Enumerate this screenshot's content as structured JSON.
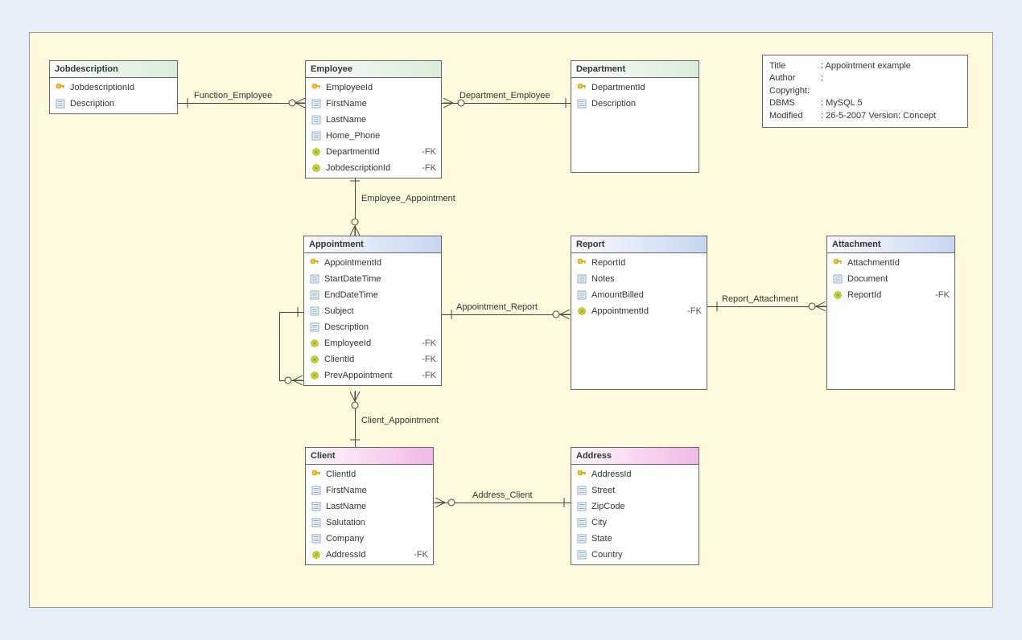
{
  "info": {
    "title_label": "Title",
    "title_value": "Appointment example",
    "author_label": "Author",
    "author_value": "",
    "copyright_label": "Copyright:",
    "dbms_label": "DBMS",
    "dbms_value": "MySQL 5",
    "modified_label": "Modified",
    "modified_value": "26-5-2007 Version: Concept"
  },
  "entities": {
    "jobdescription": {
      "title": "Jobdescription",
      "columns": [
        {
          "name": "JobdescriptionId",
          "icon": "key"
        },
        {
          "name": "Description",
          "icon": "field"
        }
      ]
    },
    "employee": {
      "title": "Employee",
      "columns": [
        {
          "name": "EmployeeId",
          "icon": "key"
        },
        {
          "name": "FirstName",
          "icon": "field"
        },
        {
          "name": "LastName",
          "icon": "field"
        },
        {
          "name": "Home_Phone",
          "icon": "field"
        },
        {
          "name": "DepartmentId",
          "icon": "fk",
          "fk": "-FK"
        },
        {
          "name": "JobdescriptionId",
          "icon": "fk",
          "fk": "-FK"
        }
      ]
    },
    "department": {
      "title": "Department",
      "columns": [
        {
          "name": "DepartmentId",
          "icon": "key"
        },
        {
          "name": "Description",
          "icon": "field"
        }
      ]
    },
    "appointment": {
      "title": "Appointment",
      "columns": [
        {
          "name": "AppointmentId",
          "icon": "key"
        },
        {
          "name": "StartDateTime",
          "icon": "field"
        },
        {
          "name": "EndDateTime",
          "icon": "field"
        },
        {
          "name": "Subject",
          "icon": "field"
        },
        {
          "name": "Description",
          "icon": "field"
        },
        {
          "name": "EmployeeId",
          "icon": "fk",
          "fk": "-FK"
        },
        {
          "name": "ClientId",
          "icon": "fk",
          "fk": "-FK"
        },
        {
          "name": "PrevAppointment",
          "icon": "fk",
          "fk": "-FK"
        }
      ]
    },
    "report": {
      "title": "Report",
      "columns": [
        {
          "name": "ReportId",
          "icon": "key"
        },
        {
          "name": "Notes",
          "icon": "field"
        },
        {
          "name": "AmountBilled",
          "icon": "field"
        },
        {
          "name": "AppointmentId",
          "icon": "fk",
          "fk": "-FK"
        }
      ]
    },
    "attachment": {
      "title": "Attachment",
      "columns": [
        {
          "name": "AttachmentId",
          "icon": "key"
        },
        {
          "name": "Document",
          "icon": "field"
        },
        {
          "name": "ReportId",
          "icon": "fk",
          "fk": "-FK"
        }
      ]
    },
    "client": {
      "title": "Client",
      "columns": [
        {
          "name": "ClientId",
          "icon": "key"
        },
        {
          "name": "FirstName",
          "icon": "field"
        },
        {
          "name": "LastName",
          "icon": "field"
        },
        {
          "name": "Salutation",
          "icon": "field"
        },
        {
          "name": "Company",
          "icon": "field"
        },
        {
          "name": "AddressId",
          "icon": "fk",
          "fk": "-FK"
        }
      ]
    },
    "address": {
      "title": "Address",
      "columns": [
        {
          "name": "AddressId",
          "icon": "key"
        },
        {
          "name": "Street",
          "icon": "field"
        },
        {
          "name": "ZipCode",
          "icon": "field"
        },
        {
          "name": "City",
          "icon": "field"
        },
        {
          "name": "State",
          "icon": "field"
        },
        {
          "name": "Country",
          "icon": "field"
        }
      ]
    }
  },
  "relationships": {
    "function_employee": "Function_Employee",
    "department_employee": "Department_Employee",
    "employee_appointment": "Employee_Appointment",
    "appointment_report": "Appointment_Report",
    "report_attachment": "Report_Attachment",
    "client_appointment": "Client_Appointment",
    "address_client": "Address_Client"
  }
}
